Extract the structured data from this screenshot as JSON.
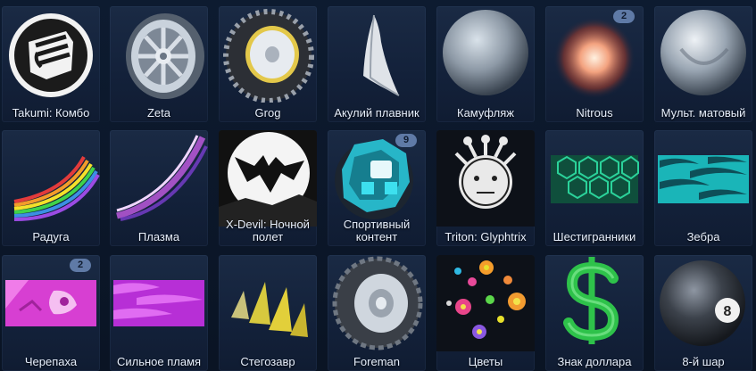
{
  "inventory": {
    "items": [
      {
        "label": "Takumi: Комбо",
        "icon": "fist-decal-icon"
      },
      {
        "label": "Zeta",
        "icon": "wheel-icon"
      },
      {
        "label": "Grog",
        "icon": "offroad-wheel-icon"
      },
      {
        "label": "Акулий плавник",
        "icon": "shark-fin-icon"
      },
      {
        "label": "Камуфляж",
        "icon": "sphere-icon"
      },
      {
        "label": "Nitrous",
        "icon": "boost-icon",
        "badge": "2"
      },
      {
        "label": "Мульт. матовый",
        "icon": "matte-sphere-icon"
      },
      {
        "label": "Радуга",
        "icon": "rainbow-trail-icon"
      },
      {
        "label": "Плазма",
        "icon": "plasma-trail-icon"
      },
      {
        "label": "X-Devil: Ночной\nполет",
        "icon": "bat-moon-icon"
      },
      {
        "label": "Спортивный\nконтент",
        "icon": "crate-icon",
        "badge": "9"
      },
      {
        "label": "Triton: Glyphtrix",
        "icon": "mask-face-icon"
      },
      {
        "label": "Шестигранники",
        "icon": "hexagon-pattern-icon"
      },
      {
        "label": "Зебра",
        "icon": "zebra-pattern-icon"
      },
      {
        "label": "Черепаха",
        "icon": "turtle-pattern-icon",
        "badge": "2"
      },
      {
        "label": "Сильное пламя",
        "icon": "flame-pattern-icon"
      },
      {
        "label": "Стегозавр",
        "icon": "spikes-icon"
      },
      {
        "label": "Foreman",
        "icon": "rim-wheel-icon"
      },
      {
        "label": "Цветы",
        "icon": "flowers-icon"
      },
      {
        "label": "Знак доллара",
        "icon": "dollar-icon"
      },
      {
        "label": "8-й шар",
        "icon": "eight-ball-icon"
      }
    ]
  },
  "colors": {
    "background": "#0b1628",
    "tile": "#16243d",
    "badge": "#5f7aa6",
    "text": "#e6eefb"
  }
}
